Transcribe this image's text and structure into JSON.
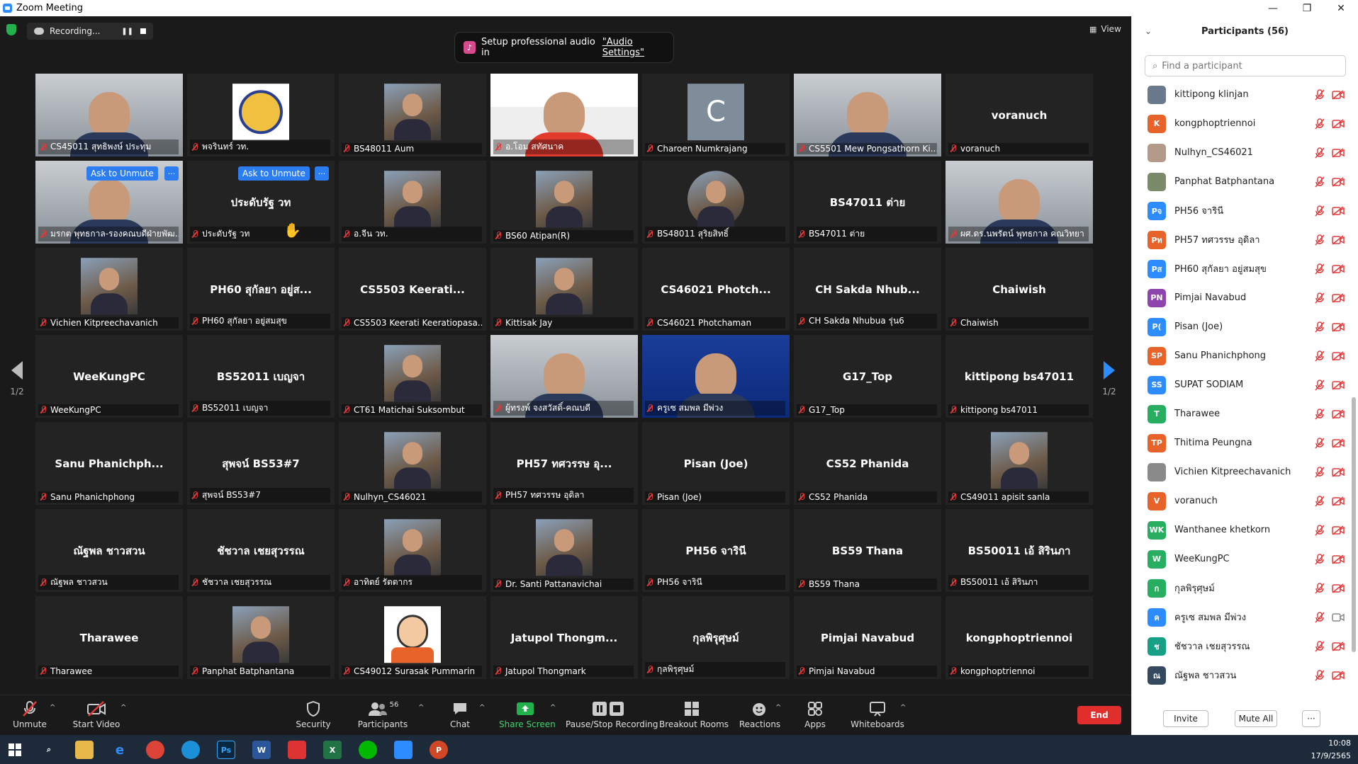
{
  "window": {
    "title": "Zoom Meeting",
    "controls": [
      "—",
      "❐",
      "✕"
    ]
  },
  "recording": {
    "label": "Recording..."
  },
  "audio_banner": {
    "prefix": "Setup professional audio in",
    "link": "\"Audio Settings\""
  },
  "view_button": {
    "label": "View"
  },
  "pager": {
    "left": "1/2",
    "right": "1/2"
  },
  "ask_unmute": {
    "label": "Ask to Unmute",
    "more": "···"
  },
  "tiles": [
    {
      "label": "CS45011 สุทธิพงษ์ ประทุม",
      "center": "",
      "kind": "video"
    },
    {
      "label": "พจรินทร์ วท.",
      "center": "",
      "kind": "logo"
    },
    {
      "label": "BS48011 Aum",
      "center": "",
      "kind": "photo"
    },
    {
      "label": "อ.โอม สทัศนาค",
      "center": "",
      "kind": "video-active"
    },
    {
      "label": "Charoen Numkrajang",
      "center": "C",
      "kind": "letter"
    },
    {
      "label": "CS5501 Mew Pongsathorn Ki...",
      "center": "",
      "kind": "video"
    },
    {
      "label": "voranuch",
      "center": "voranuch",
      "kind": "name"
    },
    {
      "label": "มรกต พุทธกาล-รองคณบดีฝ่ายพัฒ...",
      "center": "",
      "kind": "video"
    },
    {
      "label": "ประดับรัฐ วท",
      "center": "ประดับรัฐ วท",
      "kind": "name"
    },
    {
      "label": "อ.จีน วท.",
      "center": "",
      "kind": "photo"
    },
    {
      "label": "BS60 Atipan(R)",
      "center": "",
      "kind": "photo"
    },
    {
      "label": "BS48011 สุริยสิทธิ์",
      "center": "",
      "kind": "photo-round"
    },
    {
      "label": "BS47011 ต่าย",
      "center": "BS47011 ต่าย",
      "kind": "name"
    },
    {
      "label": "ผศ.ดร.นพรัตน์ พุทธกาล คณวิทยา",
      "center": "",
      "kind": "video"
    },
    {
      "label": "Vichien Kitpreechavanich",
      "center": "",
      "kind": "photo"
    },
    {
      "label": "PH60 สุกัลยา อยู่สมสุข",
      "center": "PH60 สุกัลยา อยู่ส...",
      "kind": "name"
    },
    {
      "label": "CS5503 Keerati Keeratiopasa...",
      "center": "CS5503 Keerati...",
      "kind": "name"
    },
    {
      "label": "Kittisak Jay",
      "center": "",
      "kind": "photo"
    },
    {
      "label": "CS46021 Photchaman",
      "center": "CS46021 Photch...",
      "kind": "name"
    },
    {
      "label": "CH Sakda Nhubua รุ่น6",
      "center": "CH Sakda Nhub...",
      "kind": "name"
    },
    {
      "label": "Chaiwish",
      "center": "Chaiwish",
      "kind": "name"
    },
    {
      "label": "WeeKungPC",
      "center": "WeeKungPC",
      "kind": "name"
    },
    {
      "label": "BS52011 เบญจา",
      "center": "BS52011 เบญจา",
      "kind": "name"
    },
    {
      "label": "CT61 Matichai Suksombut",
      "center": "",
      "kind": "photo"
    },
    {
      "label": "ผู้ทรงพ์ จงสวัสดิ์-คณบดี",
      "center": "",
      "kind": "video"
    },
    {
      "label": "ครูเซ สมพล มีพ่วง",
      "center": "",
      "kind": "video-blue"
    },
    {
      "label": "G17_Top",
      "center": "G17_Top",
      "kind": "name"
    },
    {
      "label": "kittipong bs47011",
      "center": "kittipong bs47011",
      "kind": "name"
    },
    {
      "label": "Sanu Phanichphong",
      "center": "Sanu  Phanichph...",
      "kind": "name"
    },
    {
      "label": "สุพจน์ BS53#7",
      "center": "สุพจน์ BS53#7",
      "kind": "name"
    },
    {
      "label": "Nulhyn_CS46021",
      "center": "",
      "kind": "photo"
    },
    {
      "label": "PH57 ทศวรรษ อุดิลา",
      "center": "PH57  ทศวรรษ  อุ...",
      "kind": "name"
    },
    {
      "label": "Pisan (Joe)",
      "center": "Pisan (Joe)",
      "kind": "name"
    },
    {
      "label": "CS52 Phanida",
      "center": "CS52 Phanida",
      "kind": "name"
    },
    {
      "label": "CS49011 apisit sanla",
      "center": "",
      "kind": "photo"
    },
    {
      "label": "ณัฐพล ชาวสวน",
      "center": "ณัฐพล ชาวสวน",
      "kind": "name"
    },
    {
      "label": "ชัชวาล  เชยสุวรรณ",
      "center": "ชัชวาล  เชยสุวรรณ",
      "kind": "name"
    },
    {
      "label": "อาทิตย์ รัตตากร",
      "center": "",
      "kind": "photo"
    },
    {
      "label": "Dr. Santi Pattanavichai",
      "center": "",
      "kind": "photo"
    },
    {
      "label": "PH56 จารินี",
      "center": "PH56 จารินี",
      "kind": "name"
    },
    {
      "label": "BS59 Thana",
      "center": "BS59 Thana",
      "kind": "name"
    },
    {
      "label": "BS50011 เอ้ สิรินภา",
      "center": "BS50011 เอ้ สิรินภา",
      "kind": "name"
    },
    {
      "label": "Tharawee",
      "center": "Tharawee",
      "kind": "name"
    },
    {
      "label": "Panphat Batphantana",
      "center": "",
      "kind": "photo"
    },
    {
      "label": "CS49012 Surasak Pummarin",
      "center": "",
      "kind": "cartoon"
    },
    {
      "label": "Jatupol Thongmark",
      "center": "Jatupol  Thongm...",
      "kind": "name"
    },
    {
      "label": "กุลพิรุศุษม์",
      "center": "กุลพิรุศุษม์",
      "kind": "name"
    },
    {
      "label": "Pimjai Navabud",
      "center": "Pimjai Navabud",
      "kind": "name"
    },
    {
      "label": "kongphoptriennoi",
      "center": "kongphoptriennoi",
      "kind": "name"
    }
  ],
  "toolbar": {
    "unmute": "Unmute",
    "start_video": "Start Video",
    "security": "Security",
    "participants": "Participants",
    "participants_count": "56",
    "chat": "Chat",
    "share_screen": "Share Screen",
    "record": "Pause/Stop Recording",
    "breakout": "Breakout Rooms",
    "reactions": "Reactions",
    "apps": "Apps",
    "whiteboards": "Whiteboards",
    "end": "End"
  },
  "panel": {
    "title": "Participants (56)",
    "search_placeholder": "Find a participant",
    "participants": [
      {
        "name": "kittipong klinjan",
        "initials": "",
        "color": "#6a7a8c",
        "photo": true,
        "video": "off"
      },
      {
        "name": "kongphoptriennoi",
        "initials": "K",
        "color": "#e8632a",
        "photo": false,
        "video": "off"
      },
      {
        "name": "Nulhyn_CS46021",
        "initials": "",
        "color": "#b39a8a",
        "photo": true,
        "video": "off"
      },
      {
        "name": "Panphat Batphantana",
        "initials": "",
        "color": "#7a8a6a",
        "photo": true,
        "video": "off"
      },
      {
        "name": "PH56 จารินี",
        "initials": "Pจ",
        "color": "#2d8cff",
        "photo": false,
        "video": "off"
      },
      {
        "name": "PH57 ทศวรรษ อุดิลา",
        "initials": "Pท",
        "color": "#e8632a",
        "photo": false,
        "video": "off"
      },
      {
        "name": "PH60 สุกัลยา อยู่สมสุข",
        "initials": "Pส",
        "color": "#2d8cff",
        "photo": false,
        "video": "off"
      },
      {
        "name": "Pimjai Navabud",
        "initials": "PN",
        "color": "#8e44ad",
        "photo": false,
        "video": "off"
      },
      {
        "name": "Pisan (Joe)",
        "initials": "P(",
        "color": "#2d8cff",
        "photo": false,
        "video": "off"
      },
      {
        "name": "Sanu Phanichphong",
        "initials": "SP",
        "color": "#e8632a",
        "photo": false,
        "video": "off"
      },
      {
        "name": "SUPAT SODIAM",
        "initials": "SS",
        "color": "#2d8cff",
        "photo": false,
        "video": "off"
      },
      {
        "name": "Tharawee",
        "initials": "T",
        "color": "#27ae60",
        "photo": false,
        "video": "off"
      },
      {
        "name": "Thitima Peungna",
        "initials": "TP",
        "color": "#e8632a",
        "photo": false,
        "video": "off"
      },
      {
        "name": "Vichien Kitpreechavanich",
        "initials": "",
        "color": "#8a8a8a",
        "photo": true,
        "video": "off"
      },
      {
        "name": "voranuch",
        "initials": "V",
        "color": "#e8632a",
        "photo": false,
        "video": "off"
      },
      {
        "name": "Wanthanee khetkorn",
        "initials": "WK",
        "color": "#27ae60",
        "photo": false,
        "video": "off"
      },
      {
        "name": "WeeKungPC",
        "initials": "W",
        "color": "#27ae60",
        "photo": false,
        "video": "off"
      },
      {
        "name": "กุลพิรุศุษม์",
        "initials": "ก",
        "color": "#27ae60",
        "photo": false,
        "video": "off"
      },
      {
        "name": "ครูเซ สมพล มีพ่วง",
        "initials": "ค",
        "color": "#2d8cff",
        "photo": false,
        "video": "on"
      },
      {
        "name": "ชัชวาล  เชยสุวรรณ",
        "initials": "ช",
        "color": "#16a085",
        "photo": false,
        "video": "off"
      },
      {
        "name": "ณัฐพล ชาวสวน",
        "initials": "ณ",
        "color": "#34495e",
        "photo": false,
        "video": "off"
      }
    ],
    "invite": "Invite",
    "mute_all": "Mute All",
    "more": "···"
  },
  "taskbar": {
    "time": "10:08",
    "date": "17/9/2565"
  },
  "colors": {
    "accent": "#2d8cff",
    "end": "#e22d2d",
    "muted": "#e03a3a",
    "share": "#22b14c"
  }
}
